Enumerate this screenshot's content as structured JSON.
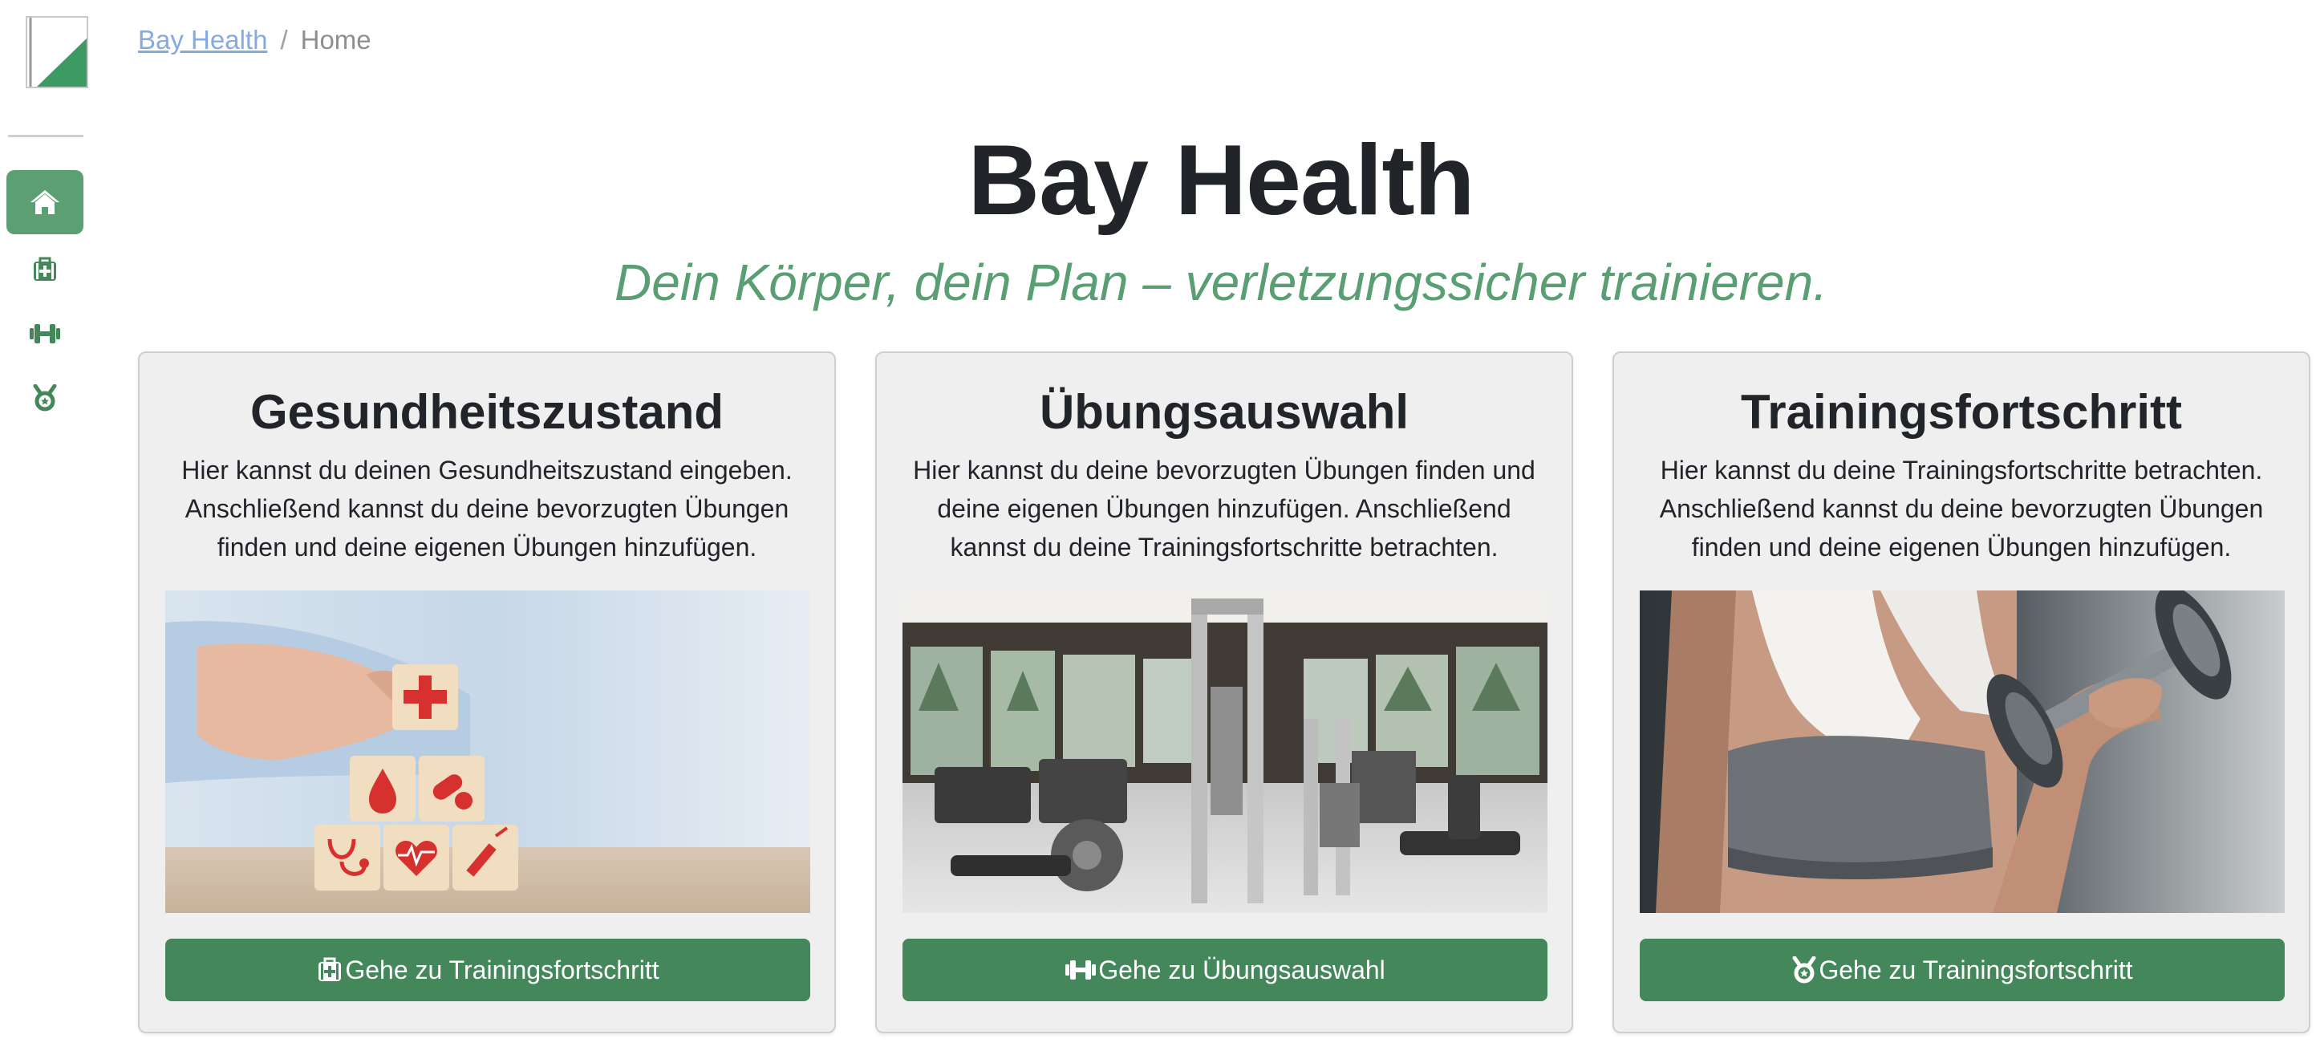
{
  "breadcrumb": {
    "home_link": "Bay Health",
    "separator": "/",
    "current": "Home"
  },
  "header": {
    "title": "Bay Health",
    "subtitle": "Dein Körper, dein Plan – verletzungssicher trainieren."
  },
  "sidebar": {
    "items": [
      {
        "icon": "home-icon",
        "active": true
      },
      {
        "icon": "medical-kit-icon",
        "active": false
      },
      {
        "icon": "dumbbell-icon",
        "active": false
      },
      {
        "icon": "medal-icon",
        "active": false
      }
    ]
  },
  "cards": [
    {
      "title": "Gesundheitszustand",
      "text": "Hier kannst du deinen Gesundheitszustand eingeben. Anschließend kannst du deine bevorzugten Übungen finden und deine eigenen Übungen hinzufügen.",
      "image": "health-blocks-image",
      "button_icon": "medical-kit-icon",
      "button_label": "Gehe zu Trainingsfortschritt"
    },
    {
      "title": "Übungsauswahl",
      "text": "Hier kannst du deine bevorzugten Übungen finden und deine eigenen Übungen hinzufügen. Anschließend kannst du deine Trainingsfortschritte betrachten.",
      "image": "gym-interior-image",
      "button_icon": "dumbbell-icon",
      "button_label": "Gehe zu Übungsauswahl"
    },
    {
      "title": "Trainingsfortschritt",
      "text": "Hier kannst du deine Trainingsfortschritte betrachten. Anschließend kannst du deine bevorzugten Übungen finden und deine eigenen Übungen hinzufügen.",
      "image": "dumbbell-workout-image",
      "button_icon": "medal-icon",
      "button_label": "Gehe zu Trainingsfortschritt"
    }
  ],
  "colors": {
    "accent": "#5c9f72",
    "button": "#43875a",
    "subtitle": "#5a9e73",
    "link": "#86a9e2",
    "card_bg": "#f0eff0"
  }
}
